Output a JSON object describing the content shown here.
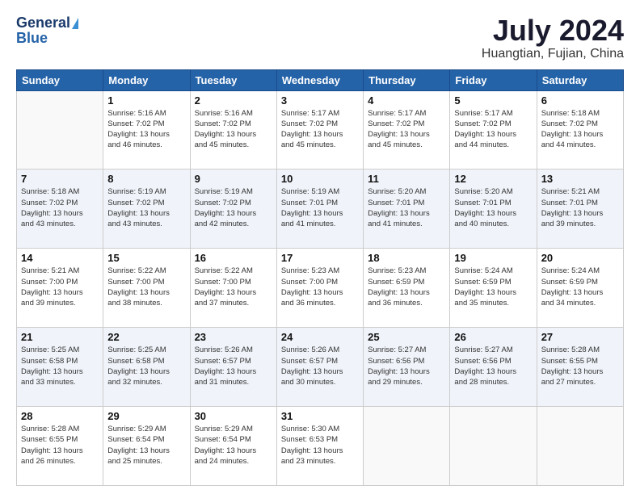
{
  "header": {
    "logo_line1": "General",
    "logo_line2": "Blue",
    "month_year": "July 2024",
    "location": "Huangtian, Fujian, China"
  },
  "weekdays": [
    "Sunday",
    "Monday",
    "Tuesday",
    "Wednesday",
    "Thursday",
    "Friday",
    "Saturday"
  ],
  "weeks": [
    [
      {
        "day": "",
        "info": ""
      },
      {
        "day": "1",
        "info": "Sunrise: 5:16 AM\nSunset: 7:02 PM\nDaylight: 13 hours\nand 46 minutes."
      },
      {
        "day": "2",
        "info": "Sunrise: 5:16 AM\nSunset: 7:02 PM\nDaylight: 13 hours\nand 45 minutes."
      },
      {
        "day": "3",
        "info": "Sunrise: 5:17 AM\nSunset: 7:02 PM\nDaylight: 13 hours\nand 45 minutes."
      },
      {
        "day": "4",
        "info": "Sunrise: 5:17 AM\nSunset: 7:02 PM\nDaylight: 13 hours\nand 45 minutes."
      },
      {
        "day": "5",
        "info": "Sunrise: 5:17 AM\nSunset: 7:02 PM\nDaylight: 13 hours\nand 44 minutes."
      },
      {
        "day": "6",
        "info": "Sunrise: 5:18 AM\nSunset: 7:02 PM\nDaylight: 13 hours\nand 44 minutes."
      }
    ],
    [
      {
        "day": "7",
        "info": "Sunrise: 5:18 AM\nSunset: 7:02 PM\nDaylight: 13 hours\nand 43 minutes."
      },
      {
        "day": "8",
        "info": "Sunrise: 5:19 AM\nSunset: 7:02 PM\nDaylight: 13 hours\nand 43 minutes."
      },
      {
        "day": "9",
        "info": "Sunrise: 5:19 AM\nSunset: 7:02 PM\nDaylight: 13 hours\nand 42 minutes."
      },
      {
        "day": "10",
        "info": "Sunrise: 5:19 AM\nSunset: 7:01 PM\nDaylight: 13 hours\nand 41 minutes."
      },
      {
        "day": "11",
        "info": "Sunrise: 5:20 AM\nSunset: 7:01 PM\nDaylight: 13 hours\nand 41 minutes."
      },
      {
        "day": "12",
        "info": "Sunrise: 5:20 AM\nSunset: 7:01 PM\nDaylight: 13 hours\nand 40 minutes."
      },
      {
        "day": "13",
        "info": "Sunrise: 5:21 AM\nSunset: 7:01 PM\nDaylight: 13 hours\nand 39 minutes."
      }
    ],
    [
      {
        "day": "14",
        "info": "Sunrise: 5:21 AM\nSunset: 7:00 PM\nDaylight: 13 hours\nand 39 minutes."
      },
      {
        "day": "15",
        "info": "Sunrise: 5:22 AM\nSunset: 7:00 PM\nDaylight: 13 hours\nand 38 minutes."
      },
      {
        "day": "16",
        "info": "Sunrise: 5:22 AM\nSunset: 7:00 PM\nDaylight: 13 hours\nand 37 minutes."
      },
      {
        "day": "17",
        "info": "Sunrise: 5:23 AM\nSunset: 7:00 PM\nDaylight: 13 hours\nand 36 minutes."
      },
      {
        "day": "18",
        "info": "Sunrise: 5:23 AM\nSunset: 6:59 PM\nDaylight: 13 hours\nand 36 minutes."
      },
      {
        "day": "19",
        "info": "Sunrise: 5:24 AM\nSunset: 6:59 PM\nDaylight: 13 hours\nand 35 minutes."
      },
      {
        "day": "20",
        "info": "Sunrise: 5:24 AM\nSunset: 6:59 PM\nDaylight: 13 hours\nand 34 minutes."
      }
    ],
    [
      {
        "day": "21",
        "info": "Sunrise: 5:25 AM\nSunset: 6:58 PM\nDaylight: 13 hours\nand 33 minutes."
      },
      {
        "day": "22",
        "info": "Sunrise: 5:25 AM\nSunset: 6:58 PM\nDaylight: 13 hours\nand 32 minutes."
      },
      {
        "day": "23",
        "info": "Sunrise: 5:26 AM\nSunset: 6:57 PM\nDaylight: 13 hours\nand 31 minutes."
      },
      {
        "day": "24",
        "info": "Sunrise: 5:26 AM\nSunset: 6:57 PM\nDaylight: 13 hours\nand 30 minutes."
      },
      {
        "day": "25",
        "info": "Sunrise: 5:27 AM\nSunset: 6:56 PM\nDaylight: 13 hours\nand 29 minutes."
      },
      {
        "day": "26",
        "info": "Sunrise: 5:27 AM\nSunset: 6:56 PM\nDaylight: 13 hours\nand 28 minutes."
      },
      {
        "day": "27",
        "info": "Sunrise: 5:28 AM\nSunset: 6:55 PM\nDaylight: 13 hours\nand 27 minutes."
      }
    ],
    [
      {
        "day": "28",
        "info": "Sunrise: 5:28 AM\nSunset: 6:55 PM\nDaylight: 13 hours\nand 26 minutes."
      },
      {
        "day": "29",
        "info": "Sunrise: 5:29 AM\nSunset: 6:54 PM\nDaylight: 13 hours\nand 25 minutes."
      },
      {
        "day": "30",
        "info": "Sunrise: 5:29 AM\nSunset: 6:54 PM\nDaylight: 13 hours\nand 24 minutes."
      },
      {
        "day": "31",
        "info": "Sunrise: 5:30 AM\nSunset: 6:53 PM\nDaylight: 13 hours\nand 23 minutes."
      },
      {
        "day": "",
        "info": ""
      },
      {
        "day": "",
        "info": ""
      },
      {
        "day": "",
        "info": ""
      }
    ]
  ]
}
